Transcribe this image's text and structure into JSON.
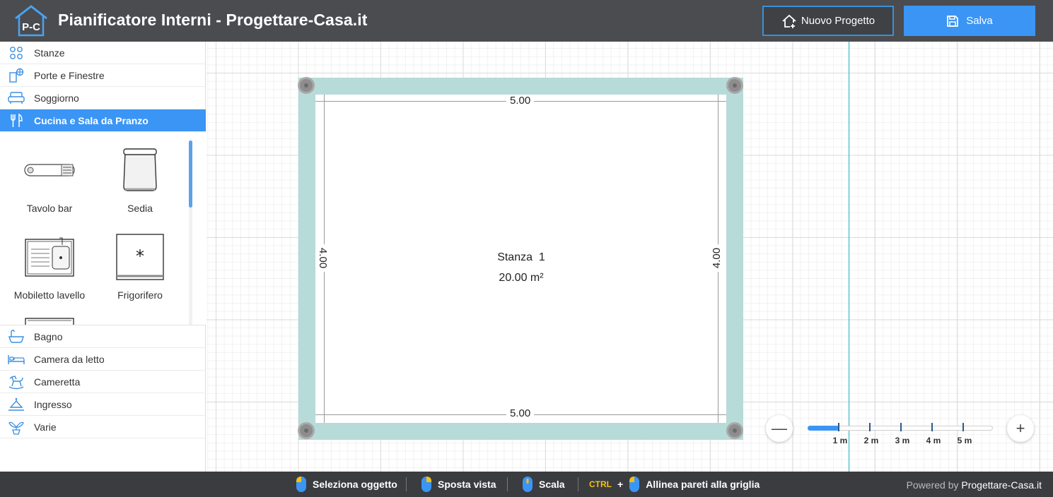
{
  "header": {
    "logo_text": "P-C",
    "title": "Pianificatore Interni - Progettare-Casa.it",
    "new_project_label": "Nuovo Progetto",
    "save_label": "Salva"
  },
  "sidebar": {
    "categories_top": [
      {
        "label": "Stanze",
        "icon": "rooms-icon"
      },
      {
        "label": "Porte e Finestre",
        "icon": "door-window-icon"
      },
      {
        "label": "Soggiorno",
        "icon": "sofa-icon"
      },
      {
        "label": "Cucina e Sala da Pranzo",
        "icon": "fork-knife-icon",
        "active": true
      }
    ],
    "items": [
      {
        "label": "Tavolo bar",
        "icon": "bar-table-icon"
      },
      {
        "label": "Sedia",
        "icon": "chair-icon"
      },
      {
        "label": "Mobiletto lavello",
        "icon": "sink-cabinet-icon"
      },
      {
        "label": "Frigorifero",
        "icon": "fridge-icon"
      }
    ],
    "categories_bottom": [
      {
        "label": "Bagno",
        "icon": "bathtub-icon"
      },
      {
        "label": "Camera da letto",
        "icon": "bed-icon"
      },
      {
        "label": "Cameretta",
        "icon": "rocking-horse-icon"
      },
      {
        "label": "Ingresso",
        "icon": "entrance-icon"
      },
      {
        "label": "Varie",
        "icon": "plant-icon"
      }
    ]
  },
  "canvas": {
    "room": {
      "name": "Stanza  1",
      "area": "20.00 m²",
      "dim_top": "5.00",
      "dim_bottom": "5.00",
      "dim_left": "4.00",
      "dim_right": "4.00"
    },
    "zoom": {
      "minus": "—",
      "plus": "+",
      "scale_labels": [
        "1 m",
        "2 m",
        "3 m",
        "4 m",
        "5 m"
      ],
      "level": 0.17
    }
  },
  "footer": {
    "hints": [
      {
        "label": "Seleziona oggetto"
      },
      {
        "label": "Sposta vista"
      },
      {
        "label": "Scala"
      },
      {
        "ctrl": "CTRL",
        "plus": "+",
        "label": "Allinea pareti alla griglia"
      }
    ],
    "powered_prefix": "Powered by",
    "powered_brand": "Progettare-Casa.it"
  },
  "colors": {
    "header_bg": "#4a4c50",
    "accent": "#3b95f5",
    "wall": "#b7dbd8",
    "guide": "#2ab4c0",
    "footer_bg": "#3a3c40"
  }
}
